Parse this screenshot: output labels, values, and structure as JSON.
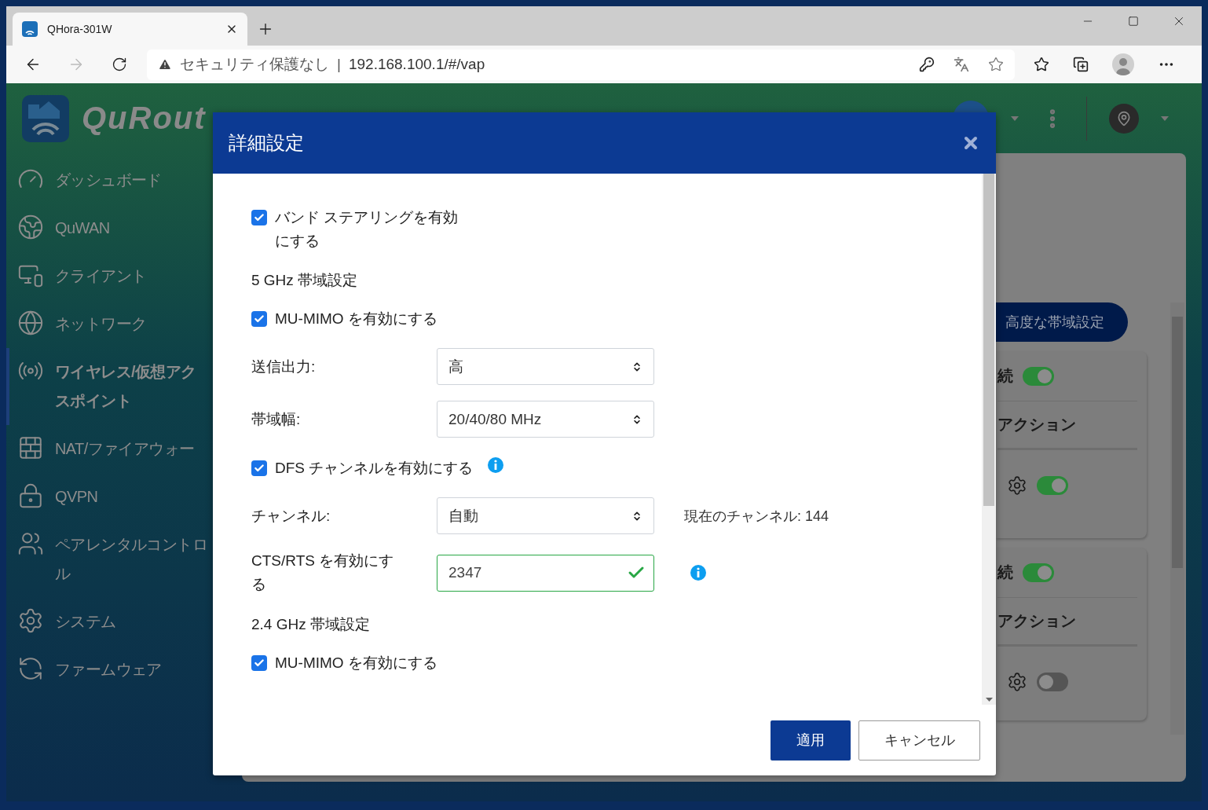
{
  "browser": {
    "tab_title": "QHora-301W",
    "security_label": "セキュリティ保護なし",
    "separator": "|",
    "url": "192.168.100.1/#/vap"
  },
  "app": {
    "brand": "QuRout"
  },
  "sidebar": {
    "items": [
      {
        "lines": [
          "ダッシュボード"
        ],
        "selected": false
      },
      {
        "lines": [
          "QuWAN"
        ],
        "selected": false
      },
      {
        "lines": [
          "クライアント"
        ],
        "selected": false
      },
      {
        "lines": [
          "ネットワーク"
        ],
        "selected": false
      },
      {
        "lines": [
          "ワイヤレス/仮想アク",
          "スポイント"
        ],
        "selected": true
      },
      {
        "lines": [
          "NAT/ファイアウォー"
        ],
        "selected": false
      },
      {
        "lines": [
          "QVPN"
        ],
        "selected": false
      },
      {
        "lines": [
          "ペアレンタルコントロ",
          "ル"
        ],
        "selected": false
      },
      {
        "lines": [
          "システム"
        ],
        "selected": false
      },
      {
        "lines": [
          "ファームウェア"
        ],
        "selected": false
      }
    ]
  },
  "background_panel": {
    "button": "高度な帯域設定",
    "cards": [
      {
        "header": "続",
        "header_on": true,
        "column": "アクション",
        "row_on": true
      },
      {
        "header": "続",
        "header_on": true,
        "column": "アクション",
        "row_on": false
      }
    ]
  },
  "dialog": {
    "title": "詳細設定",
    "items": [
      {
        "kind": "checkbox",
        "label": "バンド ステアリングを有効にする",
        "checked": true
      },
      {
        "kind": "heading",
        "label": "5 GHz 帯域設定"
      },
      {
        "kind": "checkbox",
        "label": "MU-MIMO を有効にする",
        "checked": true
      },
      {
        "kind": "select",
        "label": "送信出力:",
        "value": "高"
      },
      {
        "kind": "select",
        "label": "帯域幅:",
        "value": "20/40/80 MHz"
      },
      {
        "kind": "checkbox",
        "label": "DFS チャンネルを有効にする",
        "checked": true,
        "info": true
      },
      {
        "kind": "select",
        "label": "チャンネル:",
        "value": "自動",
        "note": "現在のチャンネル: 144"
      },
      {
        "kind": "input",
        "label": "CTS/RTS を有効にする",
        "value": "2347",
        "valid": true,
        "info": true
      },
      {
        "kind": "heading",
        "label": "2.4 GHz 帯域設定"
      },
      {
        "kind": "checkbox",
        "label": "MU-MIMO を有効にする",
        "checked": true
      }
    ],
    "buttons": [
      {
        "kind": "primary",
        "label": "適用"
      },
      {
        "kind": "secondary",
        "label": "キャンセル"
      }
    ]
  }
}
